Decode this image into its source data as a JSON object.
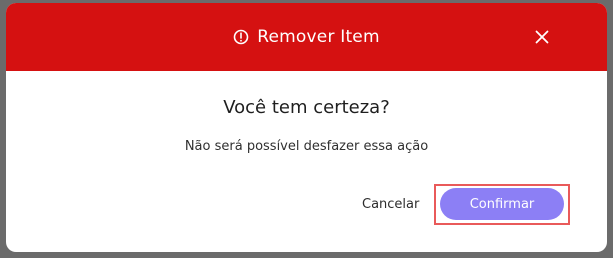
{
  "dialog": {
    "title": "Remover Item",
    "title_icon": "alert-circle-icon",
    "close_icon": "close-icon",
    "question": "Você tem certeza?",
    "message": "Não será possível desfazer essa ação",
    "cancel_label": "Cancelar",
    "confirm_label": "Confirmar"
  },
  "colors": {
    "header": "#d51111",
    "confirm": "#8c7ff5",
    "highlight": "#e95a5a",
    "backdrop": "#6b6b6b"
  }
}
